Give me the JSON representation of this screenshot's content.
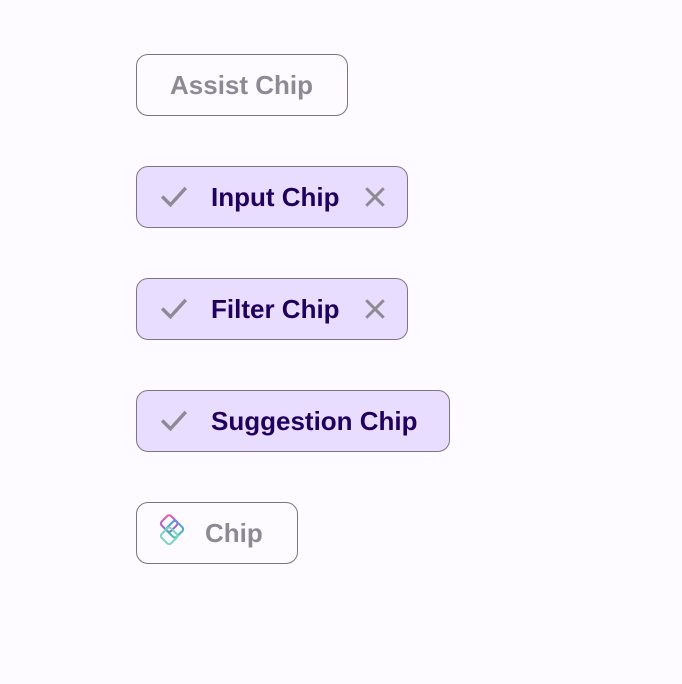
{
  "chips": {
    "assist": {
      "label": "Assist Chip",
      "state": "disabled",
      "icons": []
    },
    "input": {
      "label": "Input Chip",
      "state": "selected",
      "icons": [
        "check-icon",
        "close-icon"
      ]
    },
    "filter": {
      "label": "Filter Chip",
      "state": "selected",
      "icons": [
        "check-icon",
        "close-icon"
      ]
    },
    "suggestion": {
      "label": "Suggestion Chip",
      "state": "selected",
      "icons": [
        "check-icon"
      ]
    },
    "plain": {
      "label": "Chip",
      "state": "disabled",
      "icons": [
        "app-logo-icon"
      ]
    }
  },
  "colors": {
    "background": "#fdfbff",
    "selected_container": "#e9ddff",
    "selected_label": "#21005d",
    "disabled_label": "#8e8a94",
    "outline": "#79747e",
    "icon_gray": "#8e8a94"
  }
}
